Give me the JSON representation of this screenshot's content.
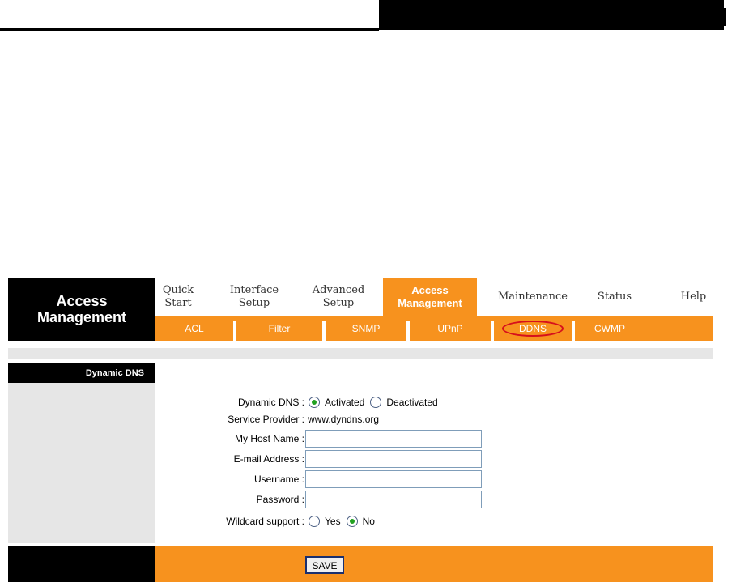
{
  "brand": {
    "line1": "Access",
    "line2": "Management"
  },
  "nav": {
    "tabs": [
      {
        "line1": "Quick",
        "line2": "Start"
      },
      {
        "line1": "Interface",
        "line2": "Setup"
      },
      {
        "line1": "Advanced",
        "line2": "Setup"
      },
      {
        "line1": "Access",
        "line2": "Management",
        "active": true
      },
      {
        "line1": "Maintenance",
        "line2": ""
      },
      {
        "line1": "Status",
        "line2": ""
      },
      {
        "line1": "Help",
        "line2": ""
      }
    ]
  },
  "subnav": {
    "tabs": [
      "ACL",
      "Filter",
      "SNMP",
      "UPnP",
      "DDNS",
      "CWMP"
    ],
    "selected": "DDNS"
  },
  "section": {
    "title": "Dynamic DNS"
  },
  "form": {
    "dynamic_dns": {
      "label": "Dynamic DNS :",
      "options": [
        "Activated",
        "Deactivated"
      ],
      "selected": "Activated"
    },
    "service_provider": {
      "label": "Service Provider :",
      "value": "www.dyndns.org"
    },
    "host_name": {
      "label": "My Host Name :",
      "value": ""
    },
    "email": {
      "label": "E-mail Address :",
      "value": ""
    },
    "username": {
      "label": "Username :",
      "value": ""
    },
    "password": {
      "label": "Password :",
      "value": ""
    },
    "wildcard": {
      "label": "Wildcard support :",
      "options": [
        "Yes",
        "No"
      ],
      "selected": "No"
    }
  },
  "footer": {
    "save_label": "SAVE"
  },
  "colors": {
    "accent": "#f7921e",
    "highlight_ring": "#d6101c",
    "panel_grey": "#e6e6e6"
  }
}
